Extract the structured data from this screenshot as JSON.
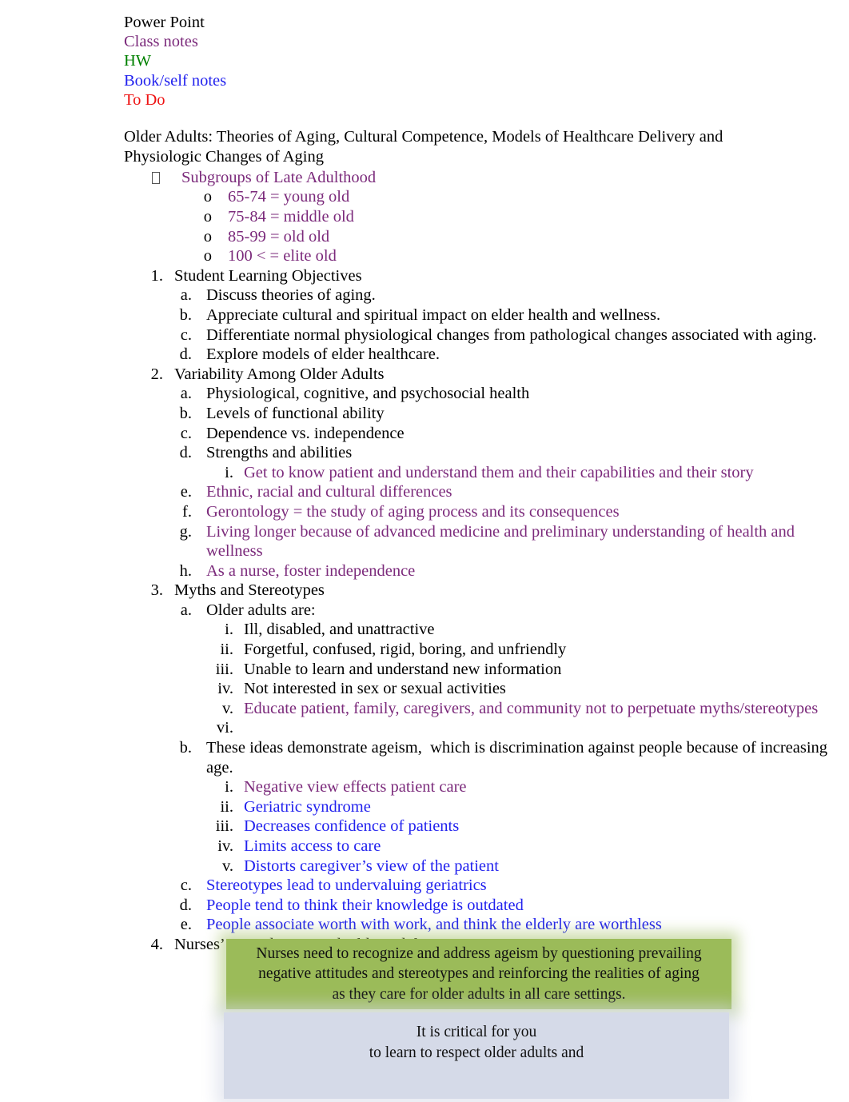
{
  "legend": {
    "items": [
      {
        "label": "Power Point",
        "color_name": "black",
        "color": "#000000"
      },
      {
        "label": "Class notes",
        "color_name": "purple",
        "color": "#7B2A7B"
      },
      {
        "label": "HW",
        "color_name": "green",
        "color": "#008000"
      },
      {
        "label": "Book/self notes",
        "color_name": "blue",
        "color": "#2222EE"
      },
      {
        "label": "To Do",
        "color_name": "red",
        "color": "#EE1111"
      }
    ]
  },
  "title": "Older Adults: Theories of Aging, Cultural Competence, Models of Healthcare Delivery and Physiologic Changes of Aging",
  "subgroups": {
    "bullet_glyph": "tofu-box-bullet",
    "heading": "Subgroups of Late Adulthood",
    "items": [
      {
        "marker": "o",
        "text": "65-74 = young old"
      },
      {
        "marker": "o",
        "text": "75-84 = middle old"
      },
      {
        "marker": "o",
        "text": "85-99 = old old"
      },
      {
        "marker": "o",
        "text": "100 < = elite old"
      }
    ]
  },
  "sections": [
    {
      "marker": "1.",
      "text": "Student Learning Objectives",
      "color": "black",
      "children": [
        {
          "marker": "a.",
          "text": "Discuss theories of aging.",
          "color": "black"
        },
        {
          "marker": "b.",
          "text": "Appreciate cultural and spiritual impact on elder health and wellness.",
          "color": "black"
        },
        {
          "marker": "c.",
          "text": "Differentiate normal physiological changes from pathological changes associated with aging.",
          "color": "black"
        },
        {
          "marker": "d.",
          "text": "Explore models of elder healthcare.",
          "color": "black"
        }
      ]
    },
    {
      "marker": "2.",
      "text": "Variability Among Older Adults",
      "color": "black",
      "children": [
        {
          "marker": "a.",
          "text": "Physiological, cognitive, and psychosocial health",
          "color": "black"
        },
        {
          "marker": "b.",
          "text": "Levels of functional ability",
          "color": "black"
        },
        {
          "marker": "c.",
          "text": "Dependence vs. independence",
          "color": "black"
        },
        {
          "marker": "d.",
          "text": "Strengths and abilities",
          "color": "black",
          "children": [
            {
              "marker": "i.",
              "text": "Get to know patient and understand them and their capabilities and their story",
              "color": "purple"
            }
          ]
        },
        {
          "marker": "e.",
          "text": "Ethnic, racial and cultural differences",
          "color": "purple"
        },
        {
          "marker": "f.",
          "text": "Gerontology = the study of aging process and its consequences",
          "color": "purple"
        },
        {
          "marker": "g.",
          "text": "Living longer because of advanced medicine and preliminary understanding of health and wellness",
          "color": "purple"
        },
        {
          "marker": "h.",
          "text": "As a nurse, foster independence",
          "color": "purple"
        }
      ]
    },
    {
      "marker": "3.",
      "text": "Myths and Stereotypes",
      "color": "black",
      "children": [
        {
          "marker": "a.",
          "text": "Older adults are:",
          "color": "black",
          "children": [
            {
              "marker": "i.",
              "text": "Ill, disabled, and unattractive",
              "color": "black"
            },
            {
              "marker": "ii.",
              "text": "Forgetful, confused, rigid, boring, and unfriendly",
              "color": "black"
            },
            {
              "marker": "iii.",
              "text": "Unable to learn and understand new information",
              "color": "black"
            },
            {
              "marker": "iv.",
              "text": "Not interested in sex or sexual activities",
              "color": "black"
            },
            {
              "marker": "v.",
              "text": "Educate patient, family, caregivers, and community not to perpetuate myths/stereotypes",
              "color": "purple"
            },
            {
              "marker": "vi.",
              "text": "",
              "color": "black"
            }
          ]
        },
        {
          "marker": "b.",
          "text": "These ideas demonstrate ageism,  which is discrimination against people because of increasing age.",
          "color": "black",
          "children": [
            {
              "marker": "i.",
              "text": "Negative view effects patient care",
              "color": "purple"
            },
            {
              "marker": "ii.",
              "text": "Geriatric syndrome",
              "color": "blue"
            },
            {
              "marker": "iii.",
              "text": "Decreases confidence of patients",
              "color": "blue"
            },
            {
              "marker": "iv.",
              "text": "Limits access to care",
              "color": "blue"
            },
            {
              "marker": "v.",
              "text": "Distorts caregiver’s view of the patient",
              "color": "blue"
            }
          ]
        },
        {
          "marker": "c.",
          "text": "Stereotypes lead to undervaluing geriatrics",
          "color": "blue"
        },
        {
          "marker": "d.",
          "text": "People tend to think their knowledge is outdated",
          "color": "blue"
        },
        {
          "marker": "e.",
          "text": "People associate worth with work, and think the elderly are worthless",
          "color": "blue"
        }
      ]
    },
    {
      "marker": "4.",
      "text": "Nurses’ Attitudes Toward Older Adults",
      "color": "black",
      "children": []
    }
  ],
  "callouts": {
    "green": {
      "text": "Nurses need to recognize and address ageism by questioning prevailing\nnegative attitudes and stereotypes and reinforcing the realities of aging\nas they care for older adults in all care settings.",
      "bg": "#9BBB59"
    },
    "blue": {
      "text": "It is critical for you\nto learn to respect  older adults and",
      "bg": "#D5DAE8"
    }
  }
}
